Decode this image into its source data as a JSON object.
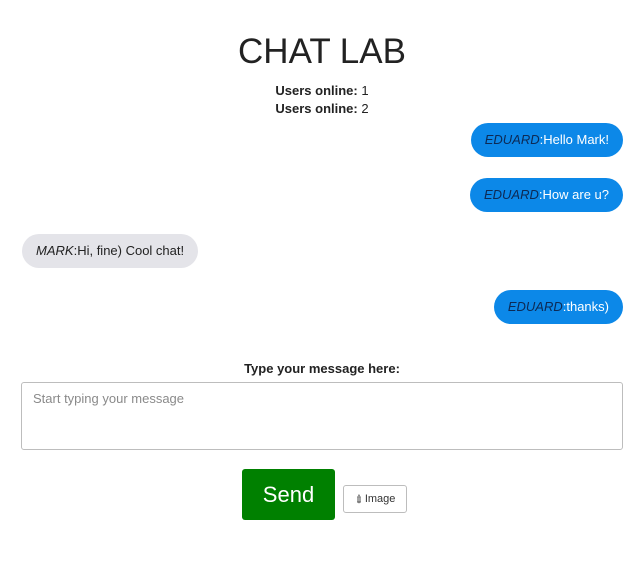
{
  "app": {
    "title": "CHAT LAB"
  },
  "online": [
    {
      "label": "Users online:",
      "count": "1"
    },
    {
      "label": "Users online:",
      "count": "2"
    }
  ],
  "messages": [
    {
      "author": "EDUARD",
      "text": "Hello Mark!",
      "side": "mine"
    },
    {
      "author": "EDUARD",
      "text": "How are u?",
      "side": "mine"
    },
    {
      "author": "MARK",
      "text": "Hi, fine) Cool chat!",
      "side": "theirs"
    },
    {
      "author": "EDUARD",
      "text": "thanks)",
      "side": "mine"
    }
  ],
  "composer": {
    "prompt": "Type your message here:",
    "placeholder": "Start typing your message",
    "value": "",
    "send_label": "Send",
    "image_label": "Image",
    "image_icon": "paperclip-icon"
  },
  "colors": {
    "own_bubble": "#0c88e8",
    "other_bubble": "#e4e4e9",
    "send_button": "#008000"
  }
}
